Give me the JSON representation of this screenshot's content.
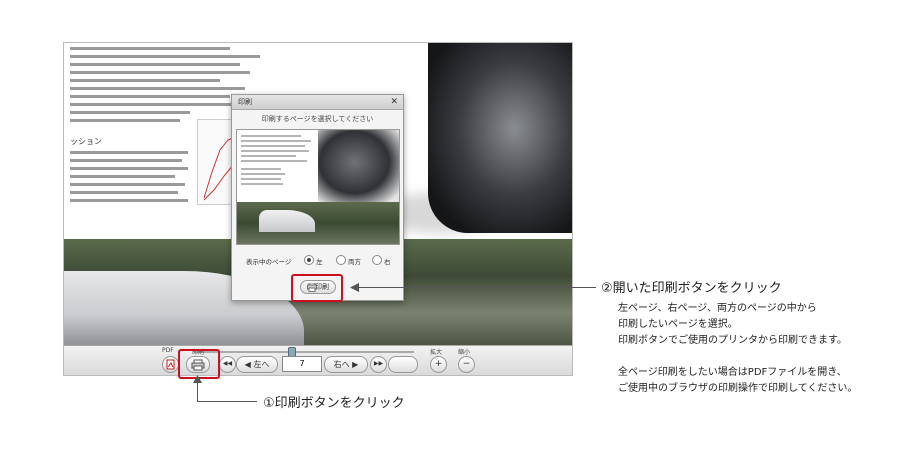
{
  "left_page": {
    "section_heading": "ッション"
  },
  "toolbar": {
    "pdf_label": "PDF",
    "print_label": "印刷",
    "zoom_in_label": "拡大",
    "zoom_out_label": "縮小",
    "prev_label": "左へ",
    "next_label": "右へ",
    "page_number": "7",
    "zoom_in_glyph": "+",
    "zoom_out_glyph": "−",
    "first_glyph": "◀◀",
    "last_glyph": "▶▶"
  },
  "dialog": {
    "title": "印刷",
    "close_glyph": "✕",
    "instruction": "印刷するページを選択してください",
    "option_label": "表示中のページ",
    "options": [
      "左",
      "両方",
      "右"
    ],
    "selected_option": "左",
    "print_button_label": "印刷"
  },
  "annotations": {
    "step1": "①印刷ボタンをクリック",
    "step2": "②開いた印刷ボタンをクリック",
    "description_lines": [
      "左ページ、右ページ、両方のページの中から",
      "印刷したいページを選択。",
      "印刷ボタンでご使用のプリンタから印刷できます。",
      "",
      "全ページ印刷をしたい場合はPDFファイルを開き、",
      "ご使用中のブラウザの印刷操作で印刷してください。"
    ],
    "highlight_color": "#cc1020"
  }
}
